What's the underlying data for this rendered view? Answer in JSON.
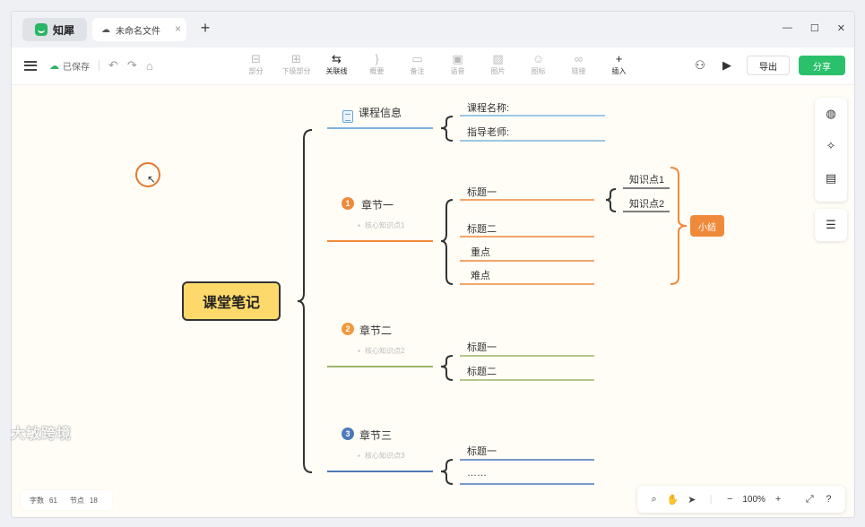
{
  "app": {
    "name": "知犀",
    "brand_color": "#2bb566"
  },
  "document_tab": {
    "title": "未命名文件",
    "icon": "cloud-icon"
  },
  "toolbar": {
    "saved_label": "已保存",
    "tools": [
      {
        "label": "部分",
        "icon": "subtopic-icon",
        "active": false
      },
      {
        "label": "下级部分",
        "icon": "child-topic-icon",
        "active": false
      },
      {
        "label": "关联线",
        "icon": "relation-line-icon",
        "active": true
      },
      {
        "label": "概要",
        "icon": "summary-icon",
        "active": false
      },
      {
        "label": "备注",
        "icon": "note-icon",
        "active": false
      },
      {
        "label": "语音",
        "icon": "voice-icon",
        "active": false
      },
      {
        "label": "图片",
        "icon": "image-icon",
        "active": false
      },
      {
        "label": "图标",
        "icon": "emoji-icon",
        "active": false
      },
      {
        "label": "链接",
        "icon": "link-icon",
        "active": false
      },
      {
        "label": "插入",
        "icon": "insert-icon",
        "active": true
      }
    ],
    "export_label": "导出",
    "share_label": "分享",
    "share_color": "#2bc06a"
  },
  "mindmap": {
    "root": "课堂笔记",
    "branches": {
      "course_info": {
        "title": "课程信息",
        "items": [
          "课程名称:",
          "指导老师:"
        ],
        "color": "#7fb3de"
      },
      "chapter1": {
        "number": "1",
        "title": "章节一",
        "note": "核心知识点1",
        "items": [
          "标题一",
          "标题二",
          "重点",
          "难点"
        ],
        "subitems": [
          "知识点1",
          "知识点2"
        ],
        "summary": "小结",
        "color": "#ef8a3b"
      },
      "chapter2": {
        "number": "2",
        "title": "章节二",
        "note": "核心知识点2",
        "items": [
          "标题一",
          "标题二"
        ],
        "color": "#9bb46a"
      },
      "chapter3": {
        "number": "3",
        "title": "章节三",
        "note": "核心知识点3",
        "items": [
          "标题一",
          "……"
        ],
        "color": "#4d79b8"
      }
    }
  },
  "status": {
    "word_count_label": "字数",
    "word_count": "61",
    "node_count_label": "节点",
    "node_count": "18"
  },
  "zoom": {
    "level": "100%"
  },
  "watermark": "大敏跨境"
}
